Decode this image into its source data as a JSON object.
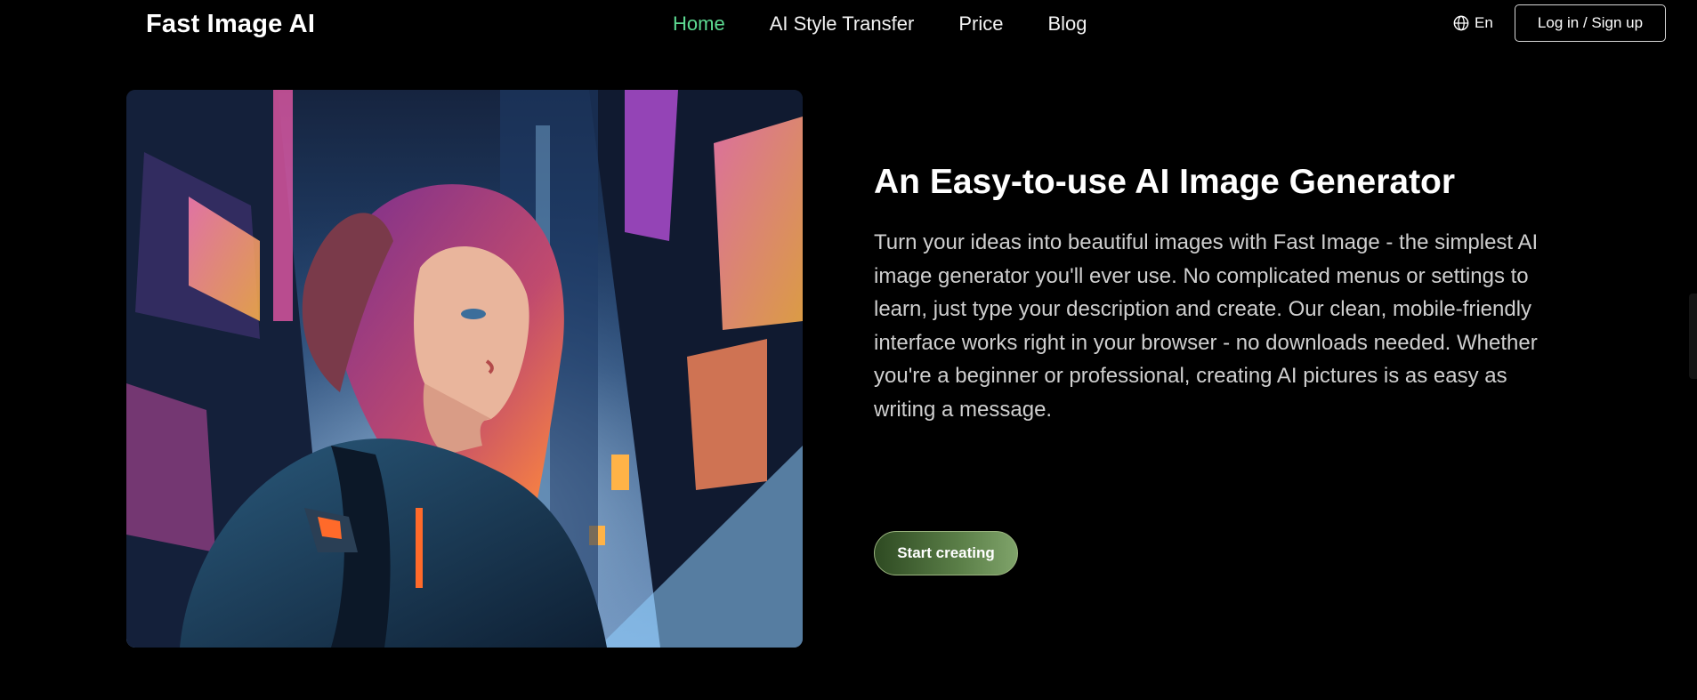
{
  "header": {
    "brand": "Fast Image AI",
    "nav": [
      {
        "label": "Home",
        "active": true
      },
      {
        "label": "AI Style Transfer",
        "active": false
      },
      {
        "label": "Price",
        "active": false
      },
      {
        "label": "Blog",
        "active": false
      }
    ],
    "language": "En",
    "login_label": "Log in / Sign up"
  },
  "hero": {
    "title": "An Easy-to-use AI Image Generator",
    "description": "Turn your ideas into beautiful images with Fast Image - the simplest AI image generator you'll ever use. No complicated menus or settings to learn, just type your description and create. Our clean, mobile-friendly interface works right in your browser - no downloads needed. Whether you're a beginner or professional, creating AI pictures is as easy as writing a message.",
    "cta_label": "Start creating"
  },
  "colors": {
    "background": "#000000",
    "nav_active": "#5ddb92",
    "cta_gradient_start": "#2e4a22",
    "cta_gradient_end": "#7fa36a"
  }
}
